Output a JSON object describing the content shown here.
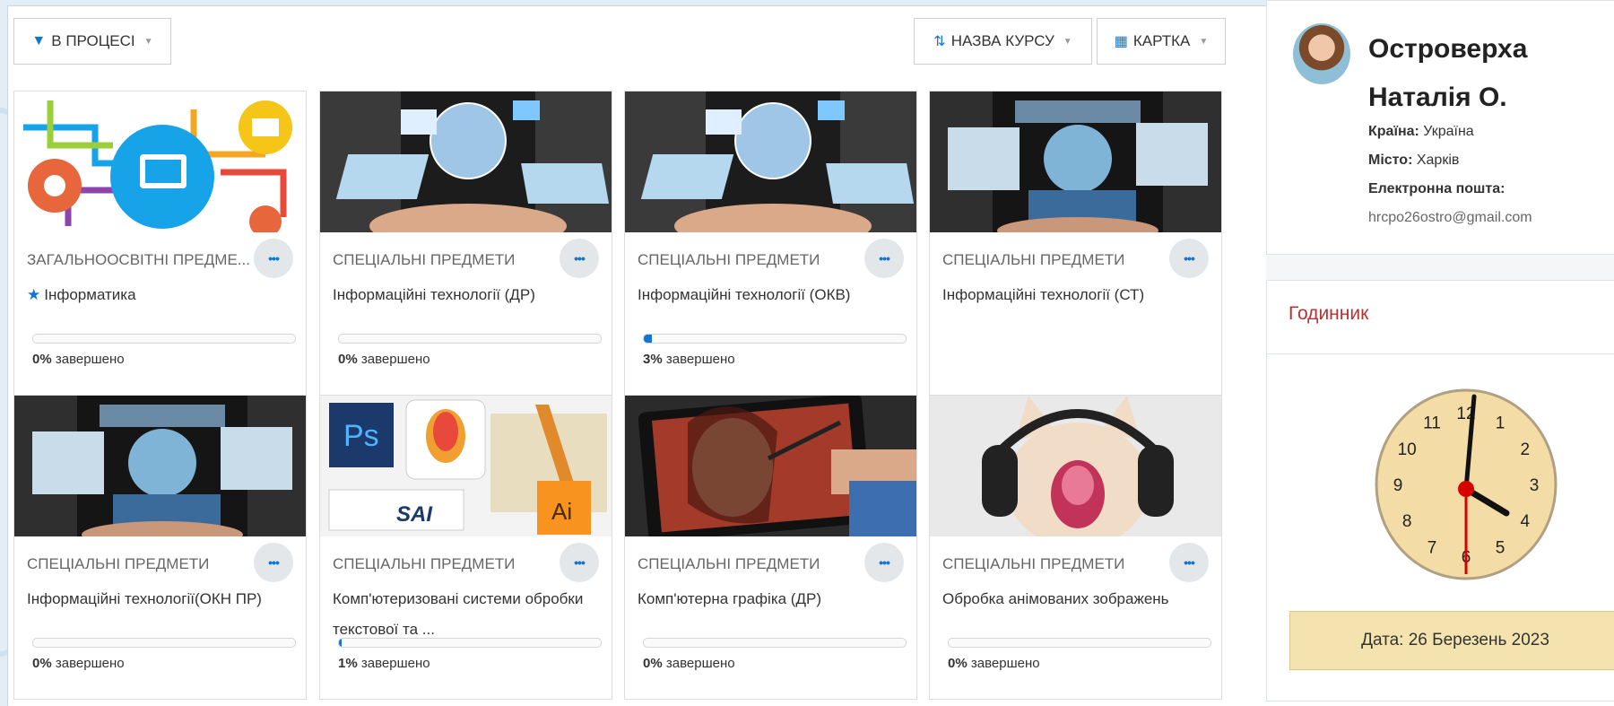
{
  "toolbar": {
    "filter_label": "В ПРОЦЕСІ",
    "sort_label": "НАЗВА КУРСУ",
    "view_label": "КАРТКА"
  },
  "courses": [
    {
      "category": "ЗАГАЛЬНООСВІТНІ ПРЕДМЕ...",
      "name": "Інформатика",
      "progress_text": "0% завершено",
      "progress": 0,
      "starred": true
    },
    {
      "category": "СПЕЦІАЛЬНІ ПРЕДМЕТИ",
      "name": "Інформаційні технології (ДР)",
      "progress_text": "0% завершено",
      "progress": 0
    },
    {
      "category": "СПЕЦІАЛЬНІ ПРЕДМЕТИ",
      "name": "Інформаційні технології (ОКВ)",
      "progress_text": "3% завершено",
      "progress": 3
    },
    {
      "category": "СПЕЦІАЛЬНІ ПРЕДМЕТИ",
      "name": "Інформаційні технології (СТ)",
      "progress_text": "",
      "progress": null
    },
    {
      "category": "СПЕЦІАЛЬНІ ПРЕДМЕТИ",
      "name": "Інформаційні технології(ОКН ПР)",
      "progress_text": "0% завершено",
      "progress": 0
    },
    {
      "category": "СПЕЦІАЛЬНІ ПРЕДМЕТИ",
      "name": "Комп'ютеризовані системи обробки текстової та ...",
      "progress_text": "1% завершено",
      "progress": 1
    },
    {
      "category": "СПЕЦІАЛЬНІ ПРЕДМЕТИ",
      "name": "Комп'ютерна графіка (ДР)",
      "progress_text": "0% завершено",
      "progress": 0
    },
    {
      "category": "СПЕЦІАЛЬНІ ПРЕДМЕТИ",
      "name": "Обробка анімованих зображень",
      "progress_text": "0% завершено",
      "progress": 0
    }
  ],
  "profile": {
    "name": "Островерха Наталія О.",
    "country_label": "Країна:",
    "country": "Україна",
    "city_label": "Місто:",
    "city": "Харків",
    "email_label": "Електронна пошта:",
    "email": "hrcpo26ostro@gmail.com"
  },
  "clock": {
    "title": "Годинник",
    "numbers": [
      "12",
      "1",
      "2",
      "3",
      "4",
      "5",
      "6",
      "7",
      "8",
      "9",
      "10",
      "11"
    ],
    "time": "4:00",
    "date_text": "Дата: 26 Березень 2023"
  },
  "colors": {
    "accent": "#1177d1",
    "clock_title": "#b83232",
    "clock_face": "#f4dca6",
    "date_box": "#f4e3ae"
  }
}
